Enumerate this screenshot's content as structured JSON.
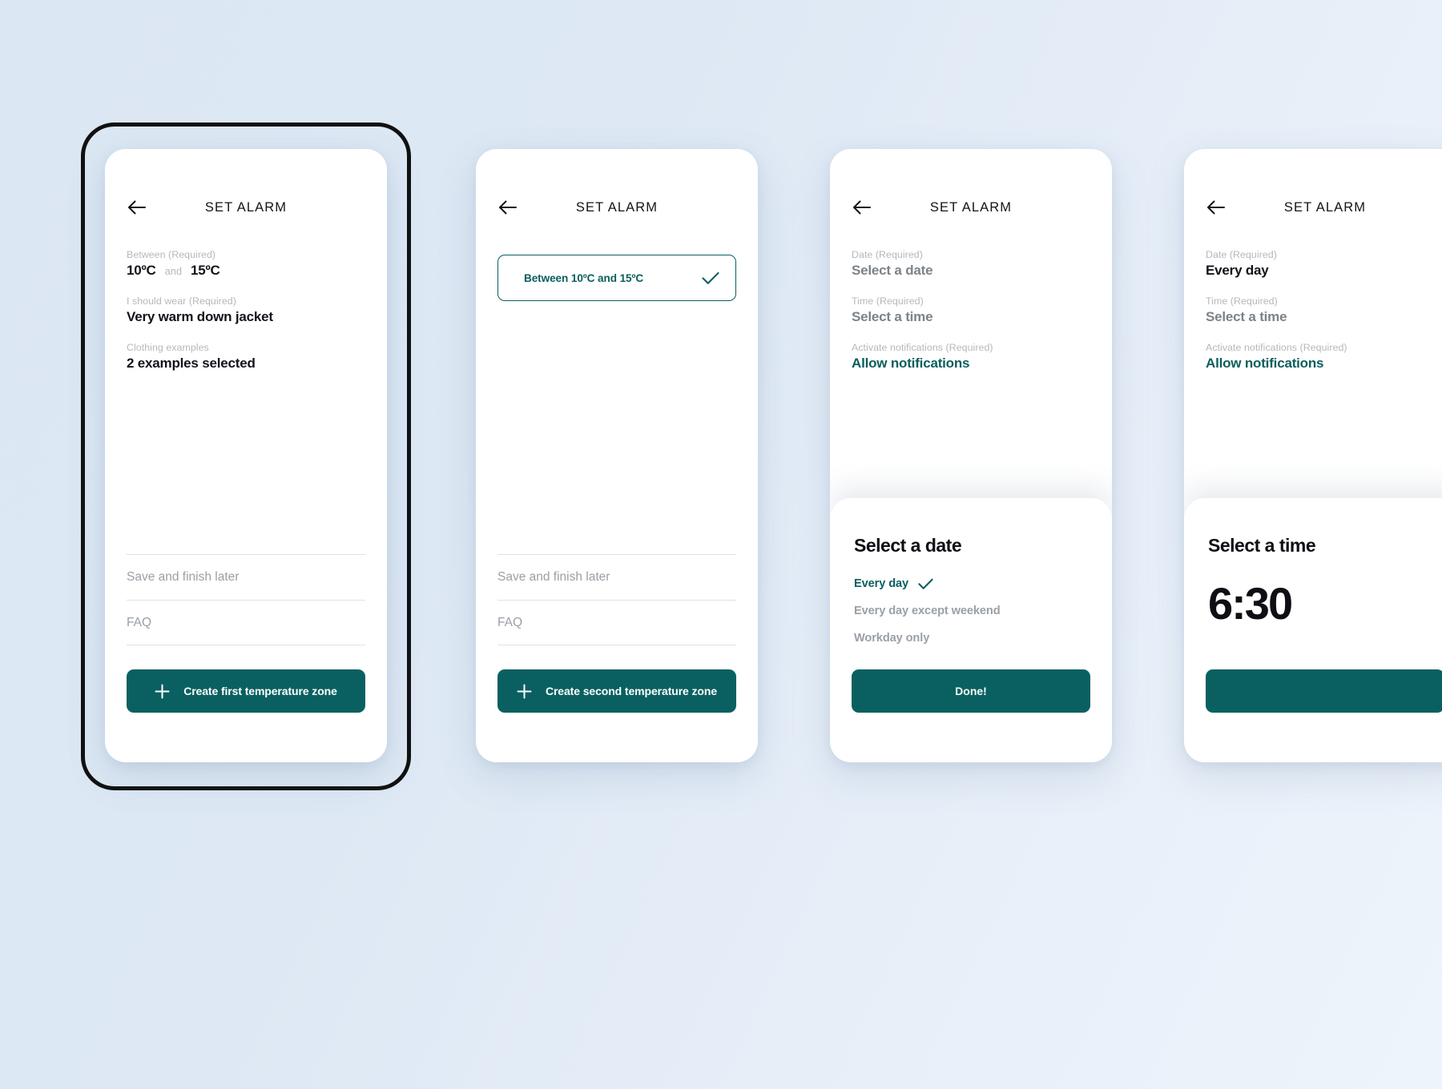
{
  "theme": {
    "accent_teal": "#0a6060",
    "accent_teal_text": "#0b5e5e",
    "background_from": "#dbe7f3",
    "background_to": "#eef4fb",
    "card_white": "#ffffff",
    "label_gray": "#b4b8bd",
    "muted_gray": "#9aa0a6",
    "text_dark": "#12141a"
  },
  "screens": [
    {
      "id": "screen-1",
      "title": "SET ALARM",
      "back_icon": "arrow-left-icon",
      "fields": [
        {
          "label": "Between (Required)",
          "type": "range",
          "value_from": "10ºC",
          "conjunction": "and",
          "value_to": "15ºC"
        },
        {
          "label": "I should wear (Required)",
          "type": "text",
          "value": "Very warm down jacket"
        },
        {
          "label": "Clothing examples",
          "type": "text",
          "value": "2 examples selected"
        }
      ],
      "links": [
        "Save and finish later",
        "FAQ"
      ],
      "primary_button": {
        "label": "Create first temperature zone",
        "icon": "plus-icon"
      }
    },
    {
      "id": "screen-2",
      "title": "SET ALARM",
      "back_icon": "arrow-left-icon",
      "chip": {
        "label": "Between 10ºC and 15ºC",
        "icon": "check-icon",
        "selected": true
      },
      "links": [
        "Save and finish later",
        "FAQ"
      ],
      "primary_button": {
        "label": "Create second temperature zone",
        "icon": "plus-icon"
      }
    },
    {
      "id": "screen-3",
      "title": "SET ALARM",
      "back_icon": "arrow-left-icon",
      "fields": [
        {
          "label": "Date (Required)",
          "type": "text",
          "value": "Select a date",
          "style": "muted"
        },
        {
          "label": "Time (Required)",
          "type": "text",
          "value": "Select a time",
          "style": "muted"
        },
        {
          "label": "Activate notifications (Required)",
          "type": "text",
          "value": "Allow notifications",
          "style": "teal"
        }
      ],
      "sheet": {
        "title": "Select a date",
        "options": [
          {
            "label": "Every day",
            "selected": true,
            "icon": "check-icon"
          },
          {
            "label": "Every day except weekend",
            "selected": false
          },
          {
            "label": "Workday only",
            "selected": false
          }
        ],
        "button_label": "Done!"
      }
    },
    {
      "id": "screen-4",
      "title": "SET ALARM",
      "back_icon": "arrow-left-icon",
      "clipped": true,
      "fields": [
        {
          "label": "Date (Required)",
          "type": "text",
          "value": "Every day",
          "style": "dark"
        },
        {
          "label": "Time (Required)",
          "type": "text",
          "value": "Select a time",
          "style": "muted"
        },
        {
          "label": "Activate notifications (Required)",
          "type": "text",
          "value": "Allow notifications",
          "style": "teal"
        }
      ],
      "sheet": {
        "title": "Select a time",
        "time_value": "6:30",
        "button_label": ""
      }
    }
  ]
}
